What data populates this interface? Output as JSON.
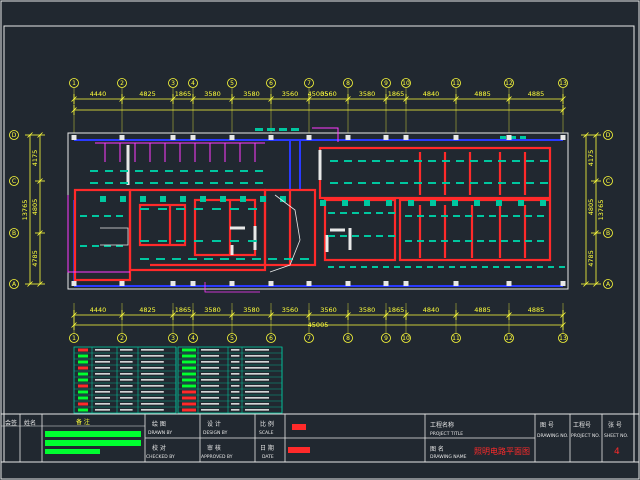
{
  "axes": {
    "columns": [
      "1",
      "2",
      "3",
      "4",
      "5",
      "6",
      "7",
      "8",
      "9",
      "10",
      "11",
      "12",
      "13"
    ],
    "rows": [
      "D",
      "C",
      "B",
      "A"
    ]
  },
  "dimensions": {
    "top_spans": [
      "4440",
      "4825",
      "1865",
      "3580",
      "3580",
      "3560",
      "3560",
      "3580",
      "1865",
      "4840",
      "4885",
      "4885"
    ],
    "bottom_spans": [
      "4440",
      "4825",
      "1865",
      "3580",
      "3580",
      "3560",
      "3560",
      "3580",
      "1865",
      "4840",
      "4885",
      "4885"
    ],
    "overall": "45005",
    "left_total": "13765",
    "left_spans": [
      "4175",
      "4805",
      "4785"
    ],
    "right_total": "13765",
    "right_spans": [
      "4175",
      "4805",
      "4785"
    ]
  },
  "title_block": {
    "project_title_cn": "工程名称",
    "project_title_en": "PROJECT TITLE",
    "drawing_title_cn": "图 名",
    "drawing_title_en": "DRAWING NAME",
    "drawing_name": "照明电路平面图",
    "drawn_cn": "绘 图",
    "drawn_en": "DRAWN BY",
    "design_cn": "设 计",
    "design_en": "DESIGN BY",
    "checked_cn": "校 对",
    "checked_en": "CHECKED BY",
    "approved_cn": "审 核",
    "approved_en": "APPROVED BY",
    "scale_cn": "比 例",
    "scale_en": "SCALE",
    "date_cn": "日 期",
    "date_en": "DATE",
    "drawing_no_cn": "图 号",
    "drawing_no_en": "DRAWING NO.",
    "project_no_cn": "工程号",
    "project_no_en": "PROJECT NO.",
    "sheet_no_cn": "张 号",
    "sheet_no_en": "SHEET NO.",
    "sheet_no": "4",
    "side_labels": [
      "会签",
      "姓名"
    ],
    "remarks": "备 注"
  },
  "colors": {
    "background": "#212830",
    "wall": "#ff2a2a",
    "fixture": "#00c8a0",
    "conduit": "#2a3aff",
    "dimension": "#ffff3a",
    "frame": "#e8e8e8",
    "magenta": "#ff3aff",
    "green": "#00ff30"
  }
}
